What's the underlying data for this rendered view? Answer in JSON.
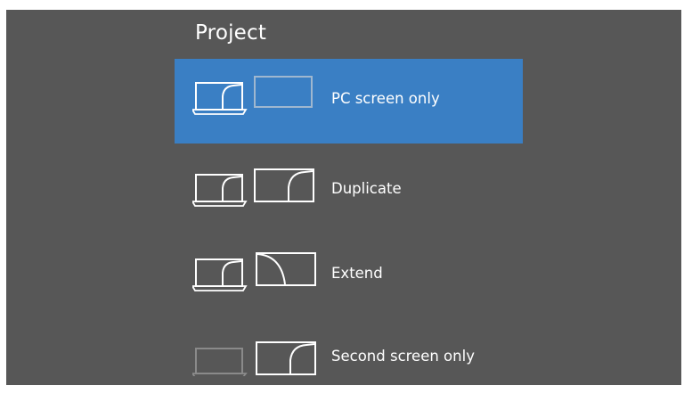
{
  "panel": {
    "title": "Project"
  },
  "options": [
    {
      "label": "PC screen only",
      "selected": true,
      "icon": "pc-screen-only-icon"
    },
    {
      "label": "Duplicate",
      "selected": false,
      "icon": "duplicate-icon"
    },
    {
      "label": "Extend",
      "selected": false,
      "icon": "extend-icon"
    },
    {
      "label": "Second screen only",
      "selected": false,
      "icon": "second-screen-only-icon"
    }
  ],
  "colors": {
    "background": "#575757",
    "selected": "#3a7fc4",
    "text": "#ffffff"
  }
}
